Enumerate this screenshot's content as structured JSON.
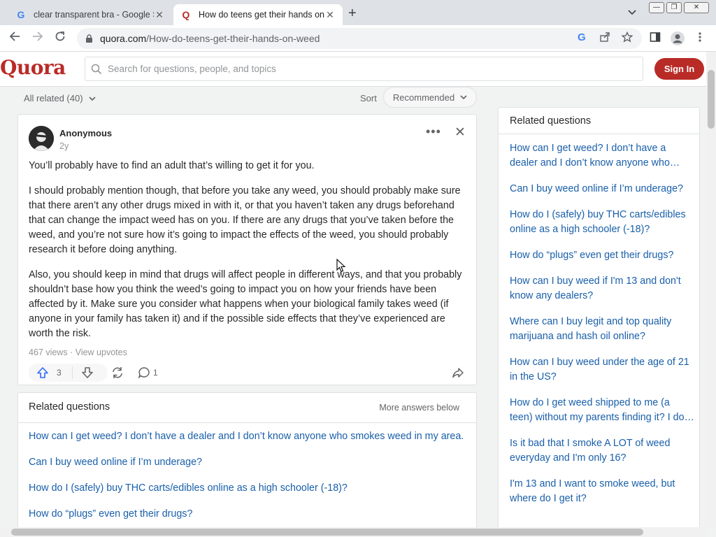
{
  "browser": {
    "tabs": [
      {
        "title": "clear transparent bra - Google Se",
        "favicon": "G",
        "active": false
      },
      {
        "title": "How do teens get their hands on",
        "favicon": "Q",
        "active": true
      }
    ],
    "new_tab": "+",
    "tab_search": "⌄",
    "url_domain": "quora.com",
    "url_path": "/How-do-teens-get-their-hands-on-weed",
    "window_controls": [
      "—",
      "❐",
      "✕"
    ]
  },
  "header": {
    "logo": "Quora",
    "search_placeholder": "Search for questions, people, and topics",
    "signin_label": "Sign In",
    "brand_color": "#b92b27"
  },
  "sort": {
    "all_related": "All related (40)",
    "sort_label": "Sort",
    "sort_value": "Recommended"
  },
  "answer": {
    "author": "Anonymous",
    "age": "2y",
    "paragraphs": [
      "You’ll probably have to find an adult that’s willing to get it for you.",
      "I should probably mention though, that before you take any weed, you should probably make sure that there aren’t any other drugs mixed in with it, or that you haven’t taken any drugs beforehand that can change the impact weed has on you. If there are any drugs that you’ve taken before the weed, and you’re not sure how it’s going to impact the effects of the weed, you should probably research it before doing anything.",
      "Also, you should keep in mind that drugs will affect people in different ways, and that you probably shouldn’t base how you think the weed’s going to impact you on how your friends have been affected by it. Make sure you consider what happens when your biological family takes weed (if anyone in your family has taken it) and if the possible side effects that they’ve experienced are worth the risk."
    ],
    "views": "467 views",
    "view_upvotes": "View upvotes",
    "upvotes": "3",
    "comments": "1"
  },
  "related_main": {
    "title": "Related questions",
    "more": "More answers below",
    "items": [
      "How can I get weed? I don’t have a dealer and I don’t know anyone who smokes weed in my area.",
      "Can I buy weed online if I’m underage?",
      "How do I (safely) buy THC carts/edibles online as a high schooler (-18)?",
      "How do “plugs” even get their drugs?"
    ]
  },
  "sidebar": {
    "title": "Related questions",
    "items": [
      "How can I get weed? I don’t have a dealer and I don’t know anyone who smokes weed in my area.",
      "Can I buy weed online if I’m underage?",
      "How do I (safely) buy THC carts/edibles online as a high schooler (-18)?",
      "How do “plugs” even get their drugs?",
      "How can I buy weed if I'm 13 and don't know any dealers?",
      "Where can I buy legit and top quality marijuana and hash oil online?",
      "How can I buy weed under the age of 21 in the US?",
      "How do I get weed shipped to me (a teen) without my parents finding it? I don't want my parents to know.",
      "Is it bad that I smoke A LOT of weed everyday and I'm only 16?",
      "I'm 13 and I want to smoke weed, but where do I get it?"
    ]
  }
}
